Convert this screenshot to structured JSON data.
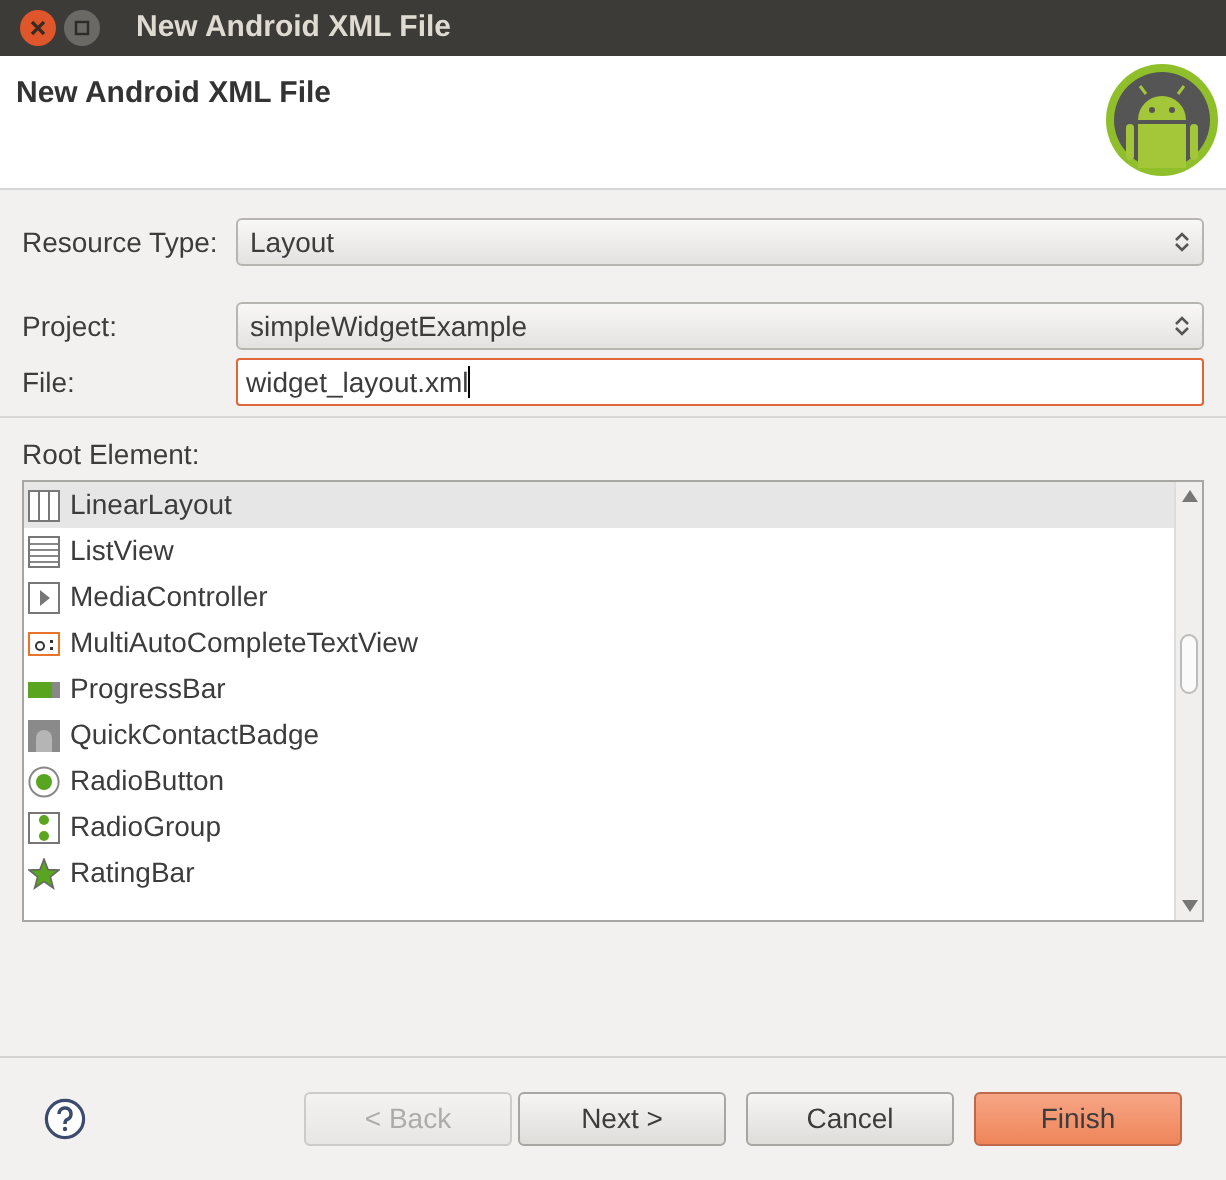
{
  "window": {
    "title": "New Android XML File"
  },
  "header": {
    "title": "New Android XML File"
  },
  "fields": [
    {
      "kind": "combo",
      "label": "Resource Type:",
      "value": "Layout"
    },
    {
      "kind": "combo",
      "label": "Project:",
      "value": "simpleWidgetExample"
    },
    {
      "kind": "text",
      "label": "File:",
      "value": "widget_layout.xml"
    }
  ],
  "root_element": {
    "label": "Root Element:",
    "items": [
      {
        "kind": "linear",
        "label": "LinearLayout",
        "selected": true
      },
      {
        "kind": "list",
        "label": "ListView",
        "selected": false
      },
      {
        "kind": "media",
        "label": "MediaController",
        "selected": false
      },
      {
        "kind": "text",
        "label": "MultiAutoCompleteTextView",
        "selected": false
      },
      {
        "kind": "progress",
        "label": "ProgressBar",
        "selected": false
      },
      {
        "kind": "badge",
        "label": "QuickContactBadge",
        "selected": false
      },
      {
        "kind": "radio",
        "label": "RadioButton",
        "selected": false
      },
      {
        "kind": "radiogroup",
        "label": "RadioGroup",
        "selected": false
      },
      {
        "kind": "rating",
        "label": "RatingBar",
        "selected": false
      }
    ]
  },
  "buttons": [
    {
      "label": "< Back",
      "disabled": true,
      "kind": "normal"
    },
    {
      "label": "Next >",
      "disabled": false,
      "kind": "normal"
    },
    {
      "label": "Cancel",
      "disabled": false,
      "kind": "normal"
    },
    {
      "label": "Finish",
      "disabled": false,
      "kind": "primary"
    }
  ]
}
